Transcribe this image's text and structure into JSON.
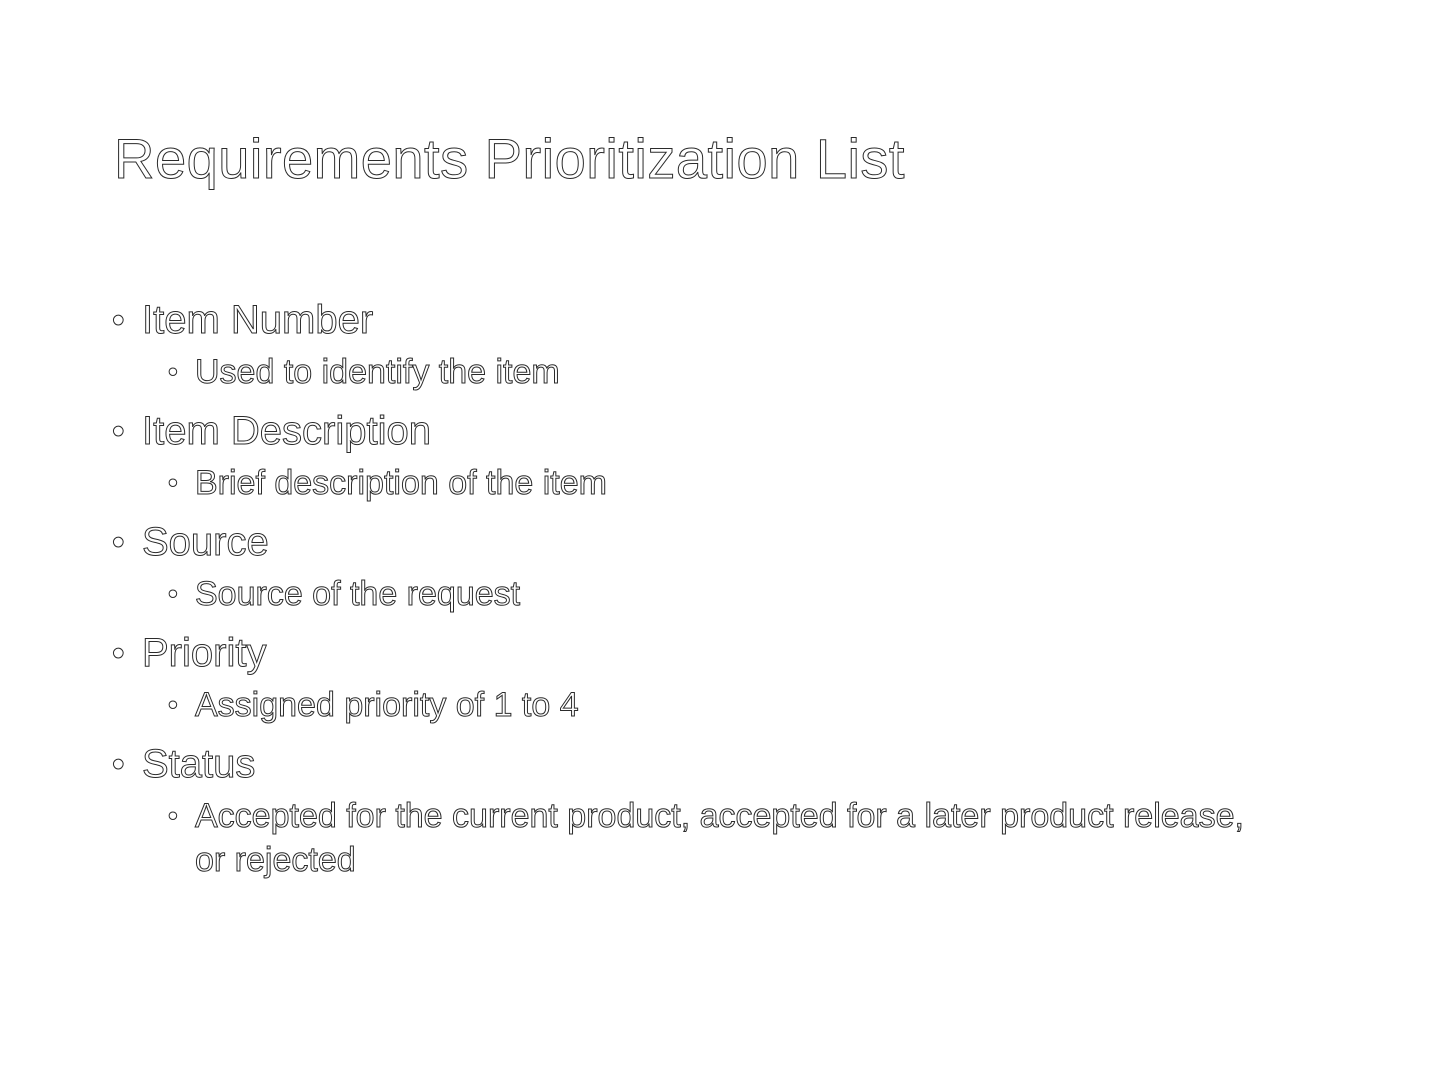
{
  "slide": {
    "title": "Requirements Prioritization List",
    "bullet_glyph": "•",
    "items": [
      {
        "heading": "Item Number",
        "detail": "Used to identify the item"
      },
      {
        "heading": "Item Description",
        "detail": "Brief description of the item"
      },
      {
        "heading": "Source",
        "detail": "Source of the request"
      },
      {
        "heading": "Priority",
        "detail": "Assigned priority of 1 to 4"
      },
      {
        "heading": "Status",
        "detail": "Accepted for the current product, accepted for a later product release, or rejected"
      }
    ]
  },
  "colors": {
    "background": "#ffffff",
    "text_fill": "#ffffff",
    "text_outline": "#2b2b2b"
  }
}
